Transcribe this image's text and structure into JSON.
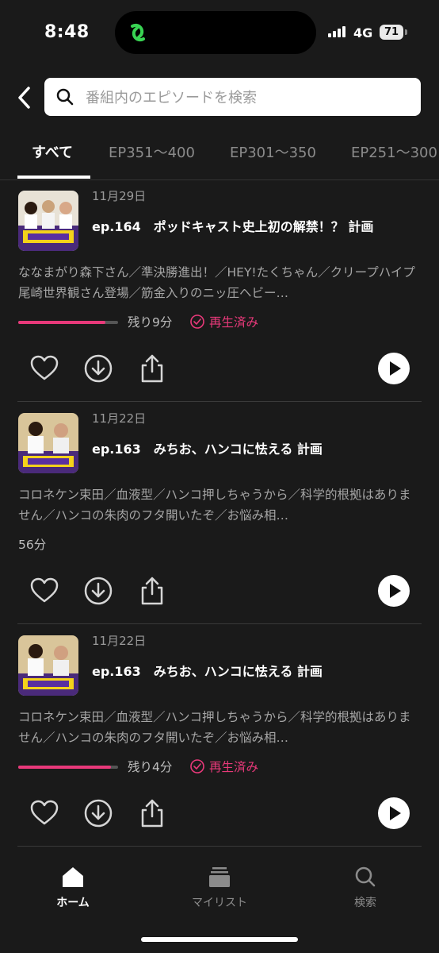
{
  "status_bar": {
    "time": "8:48",
    "network": "4G",
    "battery": "71"
  },
  "search": {
    "placeholder": "番組内のエピソードを検索"
  },
  "tabs": [
    {
      "label": "すべて"
    },
    {
      "label": "EP351〜400"
    },
    {
      "label": "EP301〜350"
    },
    {
      "label": "EP251〜300"
    }
  ],
  "episodes": [
    {
      "date": "11月29日",
      "ep": "ep.164",
      "title": "ポッドキャスト史上初の解禁！？ 計画",
      "description": "ななまがり森下さん／準決勝進出！／HEY!たくちゃん／クリープハイプ 尾崎世界観さん登場／筋金入りのニッ圧ヘビー…",
      "remaining": "残り9分",
      "played_label": "再生済み",
      "progress": 0.87
    },
    {
      "date": "11月22日",
      "ep": "ep.163",
      "title": "みちお、ハンコに怯える 計画",
      "description": "コロネケン束田／血液型／ハンコ押しちゃうから／科学的根拠はありません／ハンコの朱肉のフタ開いたぞ／お悩み相…",
      "duration": "56分"
    },
    {
      "date": "11月22日",
      "ep": "ep.163",
      "title": "みちお、ハンコに怯える 計画",
      "description": "コロネケン束田／血液型／ハンコ押しちゃうから／科学的根拠はありません／ハンコの朱肉のフタ開いたぞ／お悩み相…",
      "remaining": "残り4分",
      "played_label": "再生済み",
      "progress": 0.93
    }
  ],
  "bottom_nav": [
    {
      "label": "ホーム",
      "icon": "home-icon"
    },
    {
      "label": "マイリスト",
      "icon": "mylist-icon"
    },
    {
      "label": "検索",
      "icon": "search-icon"
    }
  ],
  "colors": {
    "accent": "#e8397a",
    "background": "#1a1a1a",
    "brand_green": "#39d353"
  }
}
